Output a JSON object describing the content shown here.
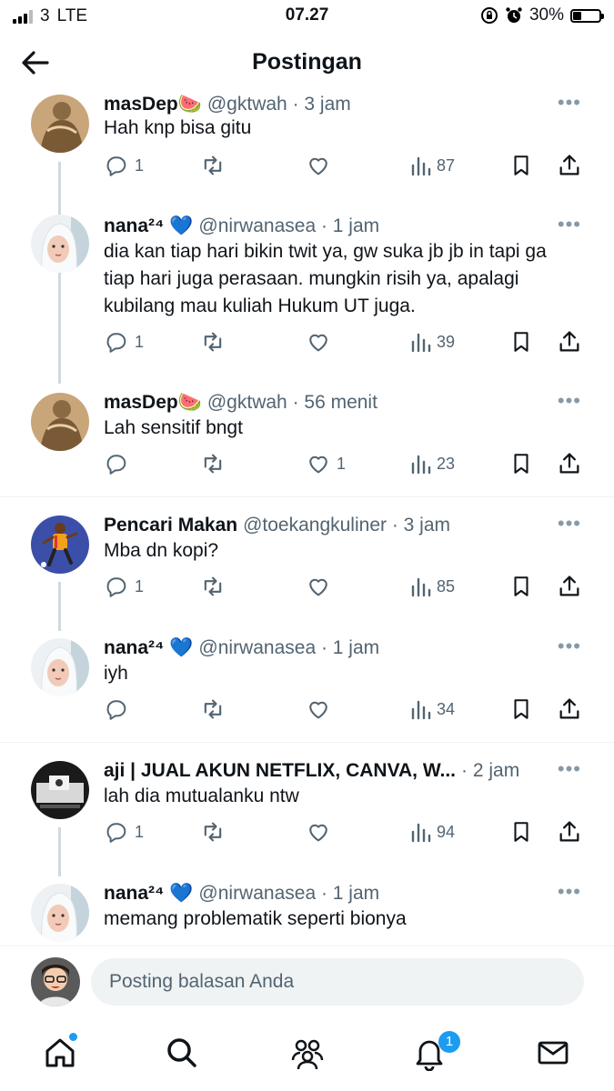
{
  "status_bar": {
    "carrier": "3",
    "network": "LTE",
    "time": "07.27",
    "battery": "30%"
  },
  "header": {
    "title": "Postingan",
    "back_icon": "arrow-left-icon"
  },
  "tweets": [
    {
      "name": "masDep",
      "emoji": "🍉",
      "verified": false,
      "handle": "@gktwah",
      "time": "· 3 jam",
      "text": "Hah knp bisa gitu",
      "replies": "1",
      "retweets": "",
      "likes": "",
      "views": "87"
    },
    {
      "name": "nana²⁴",
      "emoji": "💙",
      "verified": false,
      "handle": "@nirwanasea",
      "time": "· 1 jam",
      "text": "dia kan tiap hari bikin twit ya, gw suka jb jb in tapi ga tiap hari juga perasaan. mungkin risih ya, apalagi kubilang mau kuliah Hukum UT juga.",
      "replies": "1",
      "retweets": "",
      "likes": "",
      "views": "39"
    },
    {
      "name": "masDep",
      "emoji": "🍉",
      "verified": false,
      "handle": "@gktwah",
      "time": "· 56 menit",
      "text": "Lah sensitif bngt",
      "replies": "",
      "retweets": "",
      "likes": "1",
      "views": "23"
    },
    {
      "name": "Pencari Makan",
      "emoji": "",
      "verified": false,
      "handle": "@toekangkuliner",
      "time": "· 3 jam",
      "text": "Mba dn kopi?",
      "replies": "1",
      "retweets": "",
      "likes": "",
      "views": "85"
    },
    {
      "name": "nana²⁴",
      "emoji": "💙",
      "verified": false,
      "handle": "@nirwanasea",
      "time": "· 1 jam",
      "text": "iyh",
      "replies": "",
      "retweets": "",
      "likes": "",
      "views": "34"
    },
    {
      "name": "aji | JUAL AKUN NETFLIX, CANVA, W...",
      "emoji": "",
      "verified": false,
      "handle": "",
      "time": "· 2 jam",
      "text": "lah dia mutualanku ntw",
      "replies": "1",
      "retweets": "",
      "likes": "",
      "views": "94"
    },
    {
      "name": "nana²⁴",
      "emoji": "💙",
      "verified": false,
      "handle": "@nirwanasea",
      "time": "· 1 jam",
      "text": "memang problematik seperti bionya",
      "replies": "",
      "retweets": "",
      "likes": "",
      "views": ""
    }
  ],
  "reply_bar": {
    "placeholder": "Posting balasan Anda"
  },
  "tab_bar": {
    "notifications_badge": "1",
    "items": [
      "home-icon",
      "search-icon",
      "communities-icon",
      "notifications-icon",
      "messages-icon"
    ]
  },
  "colors": {
    "accent": "#1d9bf0",
    "muted": "#536471",
    "text": "#0f1419"
  }
}
